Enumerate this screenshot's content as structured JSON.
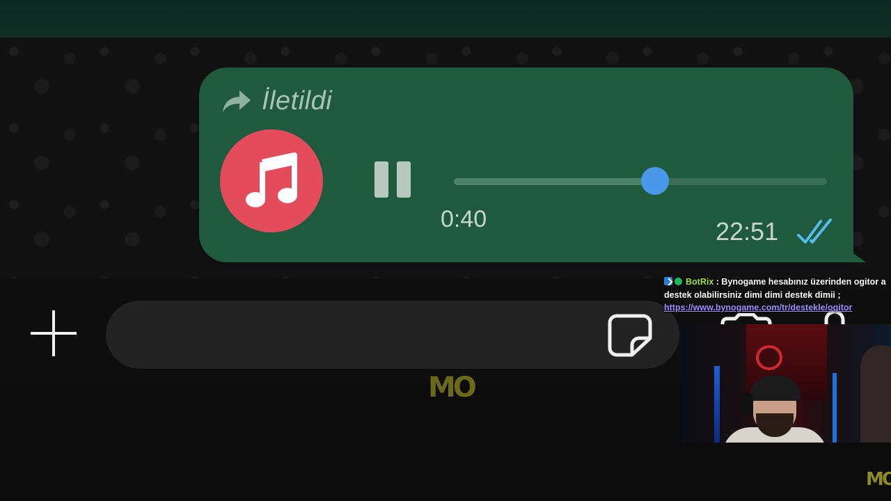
{
  "message": {
    "forwarded_label": "İletildi",
    "elapsed": "0:40",
    "time": "22:51",
    "progress_fraction": 0.54,
    "status": "read",
    "colors": {
      "bubble": "#1f5a3e",
      "avatar": "#e44c5c",
      "thumb": "#4a98ea",
      "read_ticks": "#53bdeb"
    },
    "icons": {
      "forward": "forward-arrow-icon",
      "avatar": "music-note-icon",
      "control": "pause-icon",
      "ticks": "double-check-icon"
    }
  },
  "composer": {
    "input_value": "",
    "icons": {
      "add": "plus-icon",
      "sticker": "sticker-icon"
    }
  },
  "watermark": {
    "center": "MO",
    "corner": "MO"
  },
  "chat_overlay": {
    "username": "BotRix",
    "separator": " : ",
    "message": "Bynogame hesabınız üzerinden ogitor a destek olabilirsiniz dimi dimi destek dimii ;",
    "link": "https://www.bynogame.com/tr/destekle/ogitor",
    "username_color": "#9ee645",
    "link_color": "#a58cff"
  }
}
